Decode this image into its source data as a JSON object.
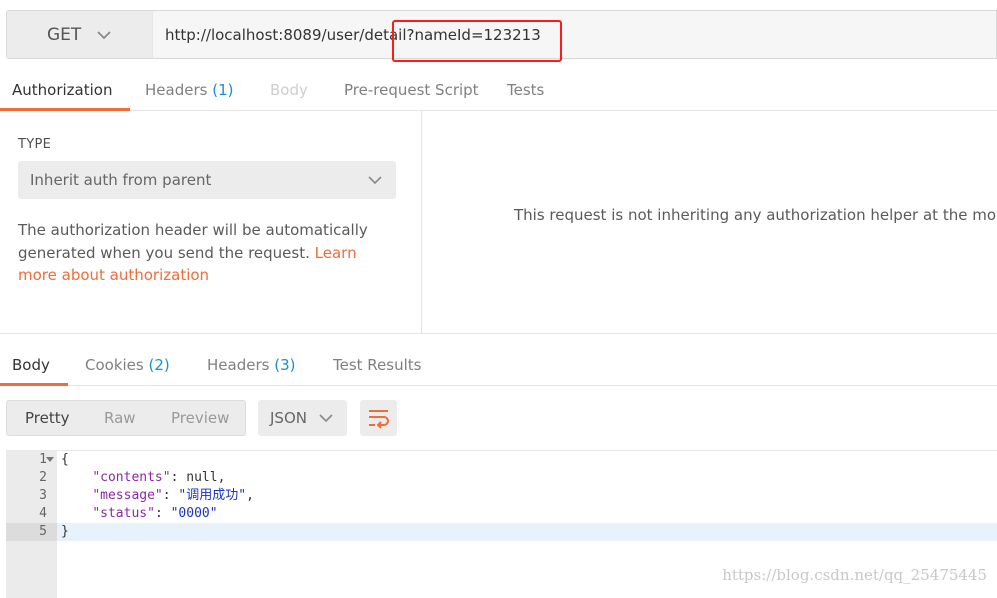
{
  "request": {
    "method": "GET",
    "url": "http://localhost:8089/user/detail?nameId=123213"
  },
  "request_tabs": [
    {
      "label": "Authorization",
      "count": ""
    },
    {
      "label": "Headers",
      "count": "(1)"
    },
    {
      "label": "Body",
      "count": ""
    },
    {
      "label": "Pre-request Script",
      "count": ""
    },
    {
      "label": "Tests",
      "count": ""
    }
  ],
  "auth": {
    "type_label": "TYPE",
    "selected_type": "Inherit auth from parent",
    "description": "The authorization header will be automatically generated when you send the request.",
    "learn_more": "Learn more about authorization",
    "right_message": "This request is not inheriting any authorization helper at the moment"
  },
  "response_tabs": [
    {
      "label": "Body",
      "count": ""
    },
    {
      "label": "Cookies",
      "count": "(2)"
    },
    {
      "label": "Headers",
      "count": "(3)"
    },
    {
      "label": "Test Results",
      "count": ""
    }
  ],
  "view_modes": [
    "Pretty",
    "Raw",
    "Preview"
  ],
  "format": "JSON",
  "code_lines": [
    {
      "n": "1",
      "text": "{"
    },
    {
      "n": "2",
      "key": "\"contents\"",
      "value": "null",
      "value_type": "lit",
      "comma": ","
    },
    {
      "n": "3",
      "key": "\"message\"",
      "value": "\"调用成功\"",
      "value_type": "str",
      "comma": ","
    },
    {
      "n": "4",
      "key": "\"status\"",
      "value": "\"0000\"",
      "value_type": "str",
      "comma": ""
    },
    {
      "n": "5",
      "text": "}"
    }
  ],
  "watermark": "https://blog.csdn.net/qq_25475445",
  "colors": {
    "accent": "#f26b3a",
    "count": "#1a8fd6",
    "highlight_box": "#ff1a1a"
  },
  "icons": [
    "chevron-down-icon",
    "wrap-lines-icon",
    "fold-arrow-icon"
  ]
}
